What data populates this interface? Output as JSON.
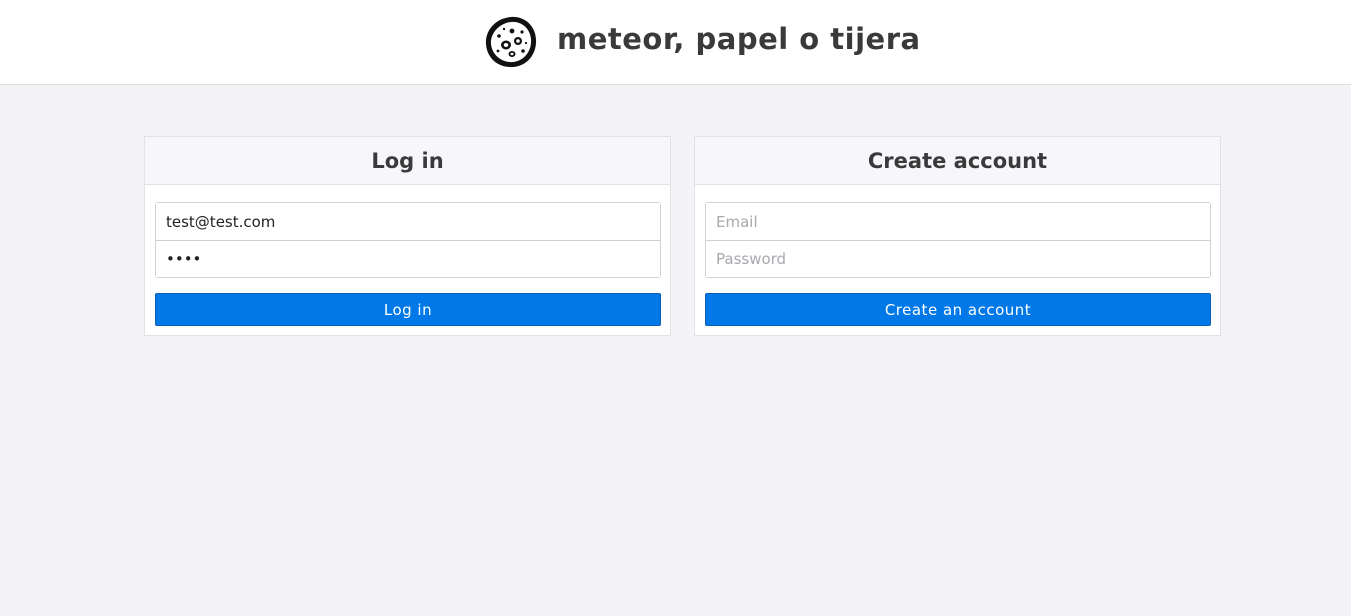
{
  "header": {
    "title": "meteor, papel o tijera",
    "logo_icon": "meteor-icon"
  },
  "login": {
    "heading": "Log in",
    "email_value": "test@test.com",
    "email_placeholder": "Email",
    "password_value": "••••",
    "password_placeholder": "Password",
    "button_label": "Log in"
  },
  "signup": {
    "heading": "Create account",
    "email_value": "",
    "email_placeholder": "Email",
    "password_value": "",
    "password_placeholder": "Password",
    "button_label": "Create an account"
  },
  "colors": {
    "accent": "#0078e7",
    "background": "#f4f4f8"
  }
}
